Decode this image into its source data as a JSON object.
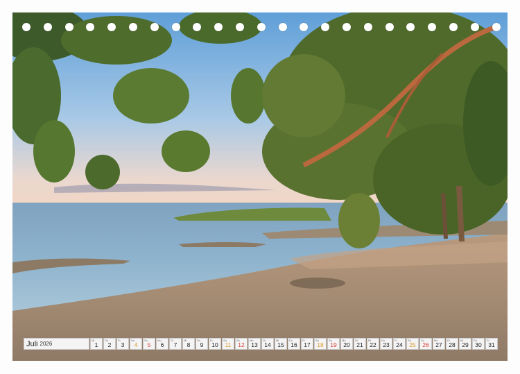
{
  "calendar": {
    "month": "Juli",
    "year": "2026",
    "days": [
      {
        "n": "1",
        "dow": "Mi",
        "type": "weekday"
      },
      {
        "n": "2",
        "dow": "Do",
        "type": "weekday"
      },
      {
        "n": "3",
        "dow": "Fr",
        "type": "weekday"
      },
      {
        "n": "4",
        "dow": "Sa",
        "type": "sat"
      },
      {
        "n": "5",
        "dow": "So",
        "type": "sun"
      },
      {
        "n": "6",
        "dow": "Mo",
        "type": "weekday"
      },
      {
        "n": "7",
        "dow": "Di",
        "type": "weekday"
      },
      {
        "n": "8",
        "dow": "Mi",
        "type": "weekday"
      },
      {
        "n": "9",
        "dow": "Do",
        "type": "weekday"
      },
      {
        "n": "10",
        "dow": "Fr",
        "type": "weekday"
      },
      {
        "n": "11",
        "dow": "Sa",
        "type": "sat"
      },
      {
        "n": "12",
        "dow": "So",
        "type": "sun"
      },
      {
        "n": "13",
        "dow": "Mo",
        "type": "weekday"
      },
      {
        "n": "14",
        "dow": "Di",
        "type": "weekday"
      },
      {
        "n": "15",
        "dow": "Mi",
        "type": "weekday"
      },
      {
        "n": "16",
        "dow": "Do",
        "type": "weekday"
      },
      {
        "n": "17",
        "dow": "Fr",
        "type": "weekday"
      },
      {
        "n": "18",
        "dow": "Sa",
        "type": "sat"
      },
      {
        "n": "19",
        "dow": "So",
        "type": "sun"
      },
      {
        "n": "20",
        "dow": "Mo",
        "type": "weekday"
      },
      {
        "n": "21",
        "dow": "Di",
        "type": "weekday"
      },
      {
        "n": "22",
        "dow": "Mi",
        "type": "weekday"
      },
      {
        "n": "23",
        "dow": "Do",
        "type": "weekday"
      },
      {
        "n": "24",
        "dow": "Fr",
        "type": "weekday"
      },
      {
        "n": "25",
        "dow": "Sa",
        "type": "sat"
      },
      {
        "n": "26",
        "dow": "So",
        "type": "sun"
      },
      {
        "n": "27",
        "dow": "Mo",
        "type": "weekday"
      },
      {
        "n": "28",
        "dow": "Di",
        "type": "weekday"
      },
      {
        "n": "29",
        "dow": "Mi",
        "type": "weekday"
      },
      {
        "n": "30",
        "dow": "Do",
        "type": "weekday"
      },
      {
        "n": "31",
        "dow": "Fr",
        "type": "weekday"
      }
    ]
  },
  "binding": {
    "hole_count": 23
  },
  "colors": {
    "saturday": "#d99a2b",
    "sunday": "#d9413a"
  }
}
